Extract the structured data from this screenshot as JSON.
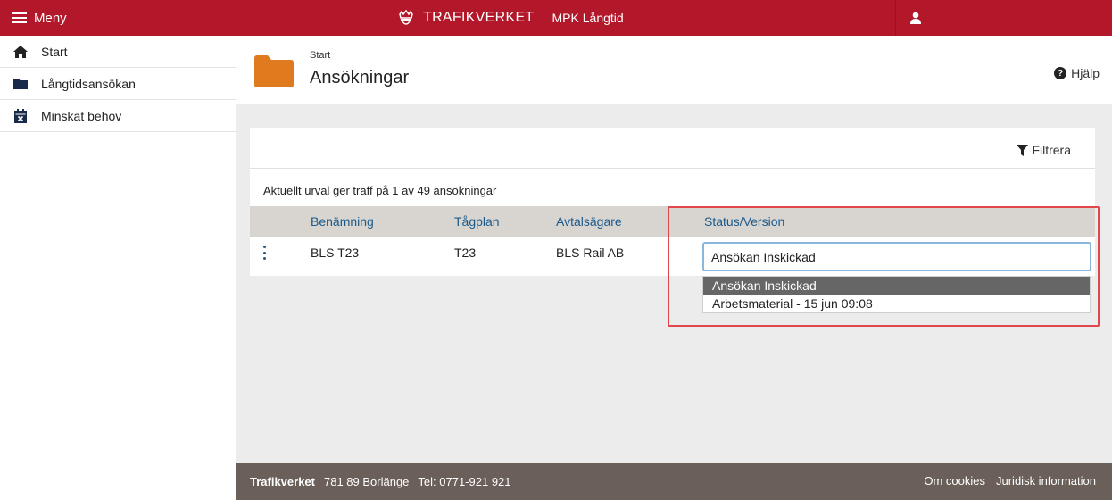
{
  "topbar": {
    "menu_label": "Meny",
    "brand_name": "TRAFIKVERKET",
    "app_name": "MPK Långtid",
    "color": "#b3182a"
  },
  "sidebar": {
    "items": [
      {
        "label": "Start",
        "icon": "home-icon"
      },
      {
        "label": "Långtidsansökan",
        "icon": "folder-icon"
      },
      {
        "label": "Minskat behov",
        "icon": "calendar-x-icon"
      }
    ]
  },
  "header": {
    "breadcrumb": "Start",
    "title": "Ansökningar",
    "help_label": "Hjälp"
  },
  "card": {
    "filter_label": "Filtrera",
    "result_text": "Aktuellt urval ger träff på 1 av 49 ansökningar",
    "columns": [
      "Benämning",
      "Tågplan",
      "Avtalsägare",
      "Status/Version"
    ],
    "rows": [
      {
        "name": "BLS T23",
        "plan": "T23",
        "owner": "BLS Rail AB",
        "status": "Ansökan Inskickad"
      }
    ],
    "status_options": [
      "Ansökan Inskickad",
      "Arbetsmaterial - 15 jun 09:08"
    ],
    "selected_option": "Ansökan Inskickad"
  },
  "footer": {
    "org": "Trafikverket",
    "address": "781 89 Borlänge",
    "phone": "Tel: 0771-921 921",
    "links": [
      "Om cookies",
      "Juridisk information"
    ]
  }
}
